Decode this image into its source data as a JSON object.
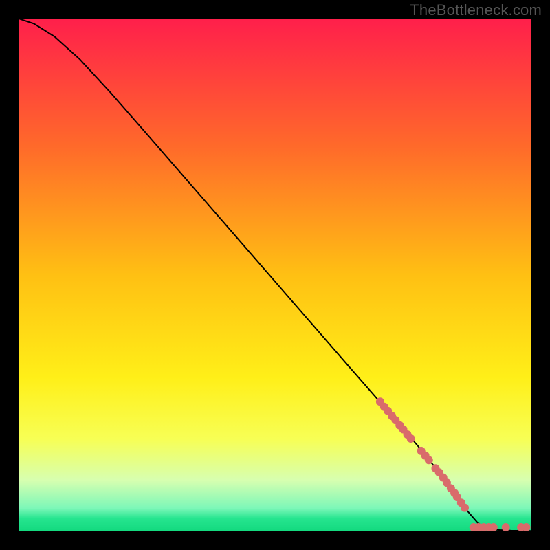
{
  "watermark": "TheBottleneck.com",
  "chart_data": {
    "type": "line",
    "title": "",
    "xlabel": "",
    "ylabel": "",
    "xlim": [
      0,
      100
    ],
    "ylim": [
      0,
      100
    ],
    "grid": false,
    "legend": false,
    "background_gradient": {
      "stops": [
        {
          "offset": 0.0,
          "color": "#ff1f4b"
        },
        {
          "offset": 0.25,
          "color": "#ff6a2a"
        },
        {
          "offset": 0.5,
          "color": "#ffc013"
        },
        {
          "offset": 0.7,
          "color": "#ffef18"
        },
        {
          "offset": 0.82,
          "color": "#f7ff55"
        },
        {
          "offset": 0.9,
          "color": "#d7ffb0"
        },
        {
          "offset": 0.955,
          "color": "#7cf7b8"
        },
        {
          "offset": 0.975,
          "color": "#26e58f"
        },
        {
          "offset": 1.0,
          "color": "#12d97e"
        }
      ]
    },
    "series": [
      {
        "name": "curve",
        "type": "line",
        "color": "#000000",
        "points": [
          {
            "x": 0.0,
            "y": 100.0
          },
          {
            "x": 3.0,
            "y": 99.0
          },
          {
            "x": 7.0,
            "y": 96.5
          },
          {
            "x": 12.0,
            "y": 92.0
          },
          {
            "x": 18.0,
            "y": 85.5
          },
          {
            "x": 25.0,
            "y": 77.5
          },
          {
            "x": 35.0,
            "y": 66.0
          },
          {
            "x": 45.0,
            "y": 54.5
          },
          {
            "x": 55.0,
            "y": 43.0
          },
          {
            "x": 65.0,
            "y": 31.5
          },
          {
            "x": 72.0,
            "y": 23.5
          },
          {
            "x": 78.0,
            "y": 16.5
          },
          {
            "x": 82.0,
            "y": 11.5
          },
          {
            "x": 85.0,
            "y": 7.5
          },
          {
            "x": 87.5,
            "y": 4.0
          },
          {
            "x": 89.5,
            "y": 1.7
          },
          {
            "x": 91.0,
            "y": 0.7
          },
          {
            "x": 93.0,
            "y": 0.3
          },
          {
            "x": 96.0,
            "y": 0.15
          },
          {
            "x": 100.0,
            "y": 0.1
          }
        ]
      },
      {
        "name": "dots-diagonal",
        "type": "scatter",
        "color": "#d96b6b",
        "radius": 6,
        "points": [
          {
            "x": 70.5,
            "y": 25.3
          },
          {
            "x": 71.3,
            "y": 24.3
          },
          {
            "x": 72.0,
            "y": 23.5
          },
          {
            "x": 72.8,
            "y": 22.5
          },
          {
            "x": 73.5,
            "y": 21.7
          },
          {
            "x": 74.3,
            "y": 20.7
          },
          {
            "x": 75.0,
            "y": 19.9
          },
          {
            "x": 75.8,
            "y": 18.9
          },
          {
            "x": 76.5,
            "y": 18.1
          },
          {
            "x": 78.5,
            "y": 15.7
          },
          {
            "x": 79.3,
            "y": 14.8
          },
          {
            "x": 80.0,
            "y": 13.9
          },
          {
            "x": 81.3,
            "y": 12.3
          },
          {
            "x": 82.0,
            "y": 11.5
          },
          {
            "x": 82.8,
            "y": 10.5
          },
          {
            "x": 83.5,
            "y": 9.5
          },
          {
            "x": 84.3,
            "y": 8.4
          },
          {
            "x": 85.0,
            "y": 7.5
          },
          {
            "x": 85.5,
            "y": 6.7
          },
          {
            "x": 86.3,
            "y": 5.6
          },
          {
            "x": 87.0,
            "y": 4.6
          }
        ]
      },
      {
        "name": "dots-bottom",
        "type": "scatter",
        "color": "#d96b6b",
        "radius": 6,
        "points": [
          {
            "x": 88.7,
            "y": 0.8
          },
          {
            "x": 89.7,
            "y": 0.8
          },
          {
            "x": 90.7,
            "y": 0.8
          },
          {
            "x": 91.7,
            "y": 0.8
          },
          {
            "x": 92.6,
            "y": 0.8
          },
          {
            "x": 95.0,
            "y": 0.8
          },
          {
            "x": 98.0,
            "y": 0.8
          },
          {
            "x": 99.0,
            "y": 0.8
          }
        ]
      }
    ]
  }
}
